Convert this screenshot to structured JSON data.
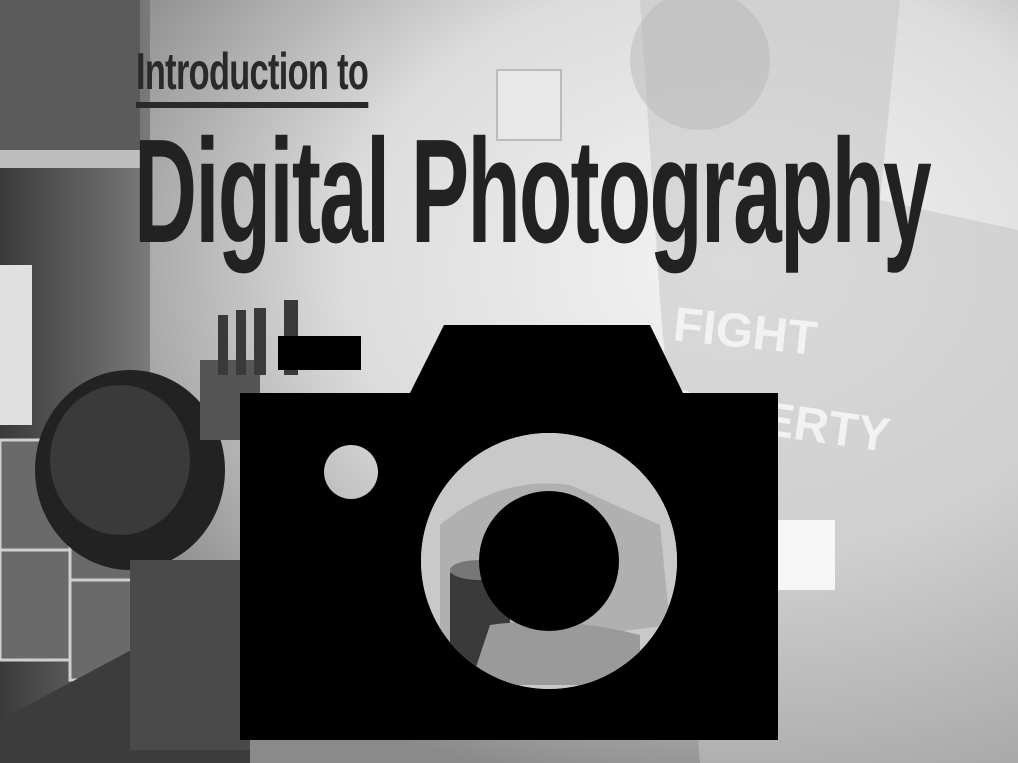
{
  "slide": {
    "subtitle": "Introduction to",
    "title": "Digital Photography",
    "shirt_text": [
      "FIGHT",
      "POVERTY"
    ]
  },
  "icons": {
    "camera": "camera-icon"
  },
  "colors": {
    "title": "#222222",
    "icon": "#000000"
  }
}
